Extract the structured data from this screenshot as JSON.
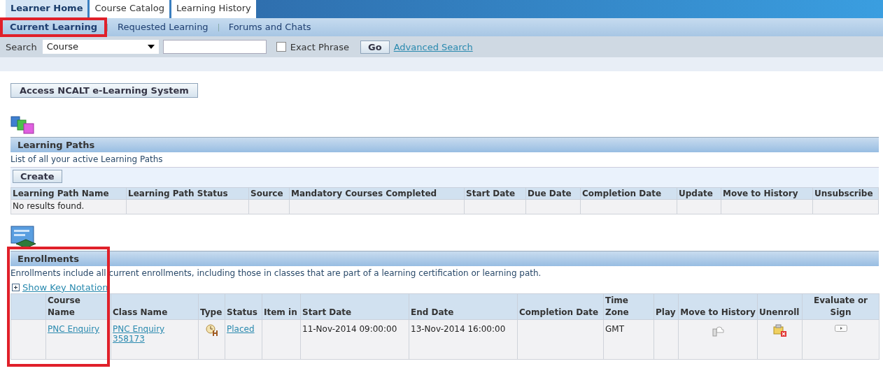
{
  "tabs": [
    {
      "label": "Learner Home",
      "selected": true
    },
    {
      "label": "Course Catalog",
      "selected": false
    },
    {
      "label": "Learning History",
      "selected": false
    }
  ],
  "subtabs": [
    {
      "label": "Current Learning",
      "selected": true,
      "annotated": true
    },
    {
      "label": "Requested Learning",
      "selected": false,
      "annotated": false
    },
    {
      "label": "Forums and Chats",
      "selected": false,
      "annotated": false
    }
  ],
  "search": {
    "label": "Search",
    "scope": "Course",
    "exact_phrase": {
      "label": "Exact Phrase",
      "checked": false
    },
    "go": "Go",
    "advanced": "Advanced Search"
  },
  "access_button": "Access NCALT e-Learning System",
  "learning_paths": {
    "title": "Learning Paths",
    "description": "List of all your active Learning Paths",
    "create": "Create",
    "columns": [
      "Learning Path Name",
      "Learning Path Status",
      "Source",
      "Mandatory Courses Completed",
      "Start Date",
      "Due Date",
      "Completion Date",
      "Update",
      "Move to History",
      "Unsubscribe"
    ],
    "empty": "No results found."
  },
  "enrollments": {
    "title": "Enrollments",
    "description": "Enrollments include all current enrollments, including those in classes that are part of a learning certification or learning path.",
    "key_notation": "Show Key Notation",
    "columns": [
      {
        "annotated": false
      },
      {
        "label": "Course Name",
        "annotated": true
      },
      {
        "label": "Class Name",
        "annotated": false
      },
      {
        "label": "Type",
        "annotated": false
      },
      {
        "label": "Status",
        "annotated": false
      },
      {
        "label": "Item in",
        "annotated": false
      },
      {
        "label": "Start Date",
        "annotated": false
      },
      {
        "label": "End Date",
        "annotated": false
      },
      {
        "label": "Completion Date",
        "annotated": false
      },
      {
        "label": "Time Zone",
        "annotated": false
      },
      {
        "label": "Play",
        "annotated": false
      },
      {
        "label": "Move to History",
        "annotated": false
      },
      {
        "label": "Unenroll",
        "annotated": false
      },
      {
        "label": "Evaluate or Sign",
        "annotated": false
      }
    ],
    "rows": [
      {
        "cells": [
          {
            "kind": "empty"
          },
          {
            "kind": "link",
            "text": "PNC Enquiry"
          },
          {
            "kind": "link",
            "text": "PNC Enquiry 358173"
          },
          {
            "kind": "icon"
          },
          {
            "kind": "link",
            "text": "Placed"
          },
          {
            "kind": "empty"
          },
          {
            "kind": "text",
            "text": "11-Nov-2014 09:00:00"
          },
          {
            "kind": "text",
            "text": "13-Nov-2014 16:00:00"
          },
          {
            "kind": "empty"
          },
          {
            "kind": "text",
            "text": "GMT"
          },
          {
            "kind": "empty"
          },
          {
            "kind": "icon"
          },
          {
            "kind": "icon"
          },
          {
            "kind": "icon"
          }
        ]
      }
    ]
  }
}
